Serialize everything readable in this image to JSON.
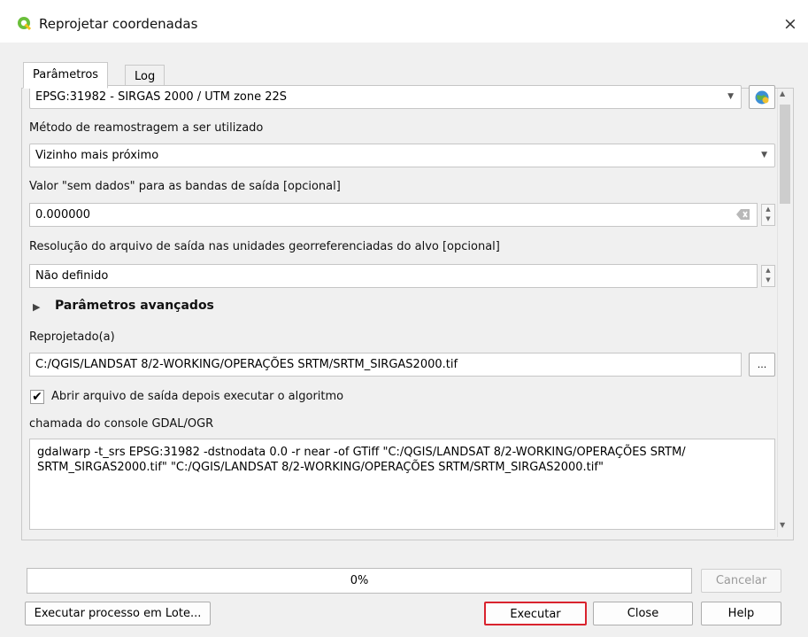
{
  "window": {
    "title": "Reprojetar coordenadas",
    "icon": "qgis-icon",
    "close_label": "×",
    "colors": {
      "app_icon_green": "#6abf3a",
      "highlight_red": "#d9232e"
    }
  },
  "tabs": [
    {
      "label": "Parâmetros",
      "active": true
    },
    {
      "label": "Log",
      "active": false
    }
  ],
  "params": {
    "target_crs": "EPSG:31982 - SIRGAS 2000 / UTM zone 22S",
    "resampling_label": "Método de reamostragem a ser utilizado",
    "resampling_value": "Vizinho mais próximo",
    "nodata_label": "Valor \"sem dados\" para as bandas de saída [opcional]",
    "nodata_value": "0.000000",
    "resolution_label": "Resolução do arquivo de saída nas unidades georreferenciadas do alvo [opcional]",
    "resolution_value": "Não definido",
    "advanced_label": "Parâmetros avançados",
    "output_label": "Reprojetado(a)",
    "output_value": "C:/QGIS/LANDSAT 8/2-WORKING/OPERAÇÕES SRTM/SRTM_SIRGAS2000.tif",
    "browse_label": "...",
    "open_output_label": "Abrir arquivo de saída depois executar o algoritmo",
    "open_output_checked": true,
    "console_label": "chamada do console GDAL/OGR",
    "console_command": "gdalwarp -t_srs EPSG:31982 -dstnodata 0.0 -r near -of GTiff \"C:/QGIS/LANDSAT 8/2-WORKING/OPERAÇÕES SRTM/\nSRTM_SIRGAS2000.tif\" \"C:/QGIS/LANDSAT 8/2-WORKING/OPERAÇÕES SRTM/SRTM_SIRGAS2000.tif\""
  },
  "progress": {
    "percent_label": "0%",
    "value": 0
  },
  "buttons": {
    "cancel": "Cancelar",
    "batch": "Executar processo em Lote...",
    "run": "Executar",
    "close": "Close",
    "help": "Help"
  }
}
